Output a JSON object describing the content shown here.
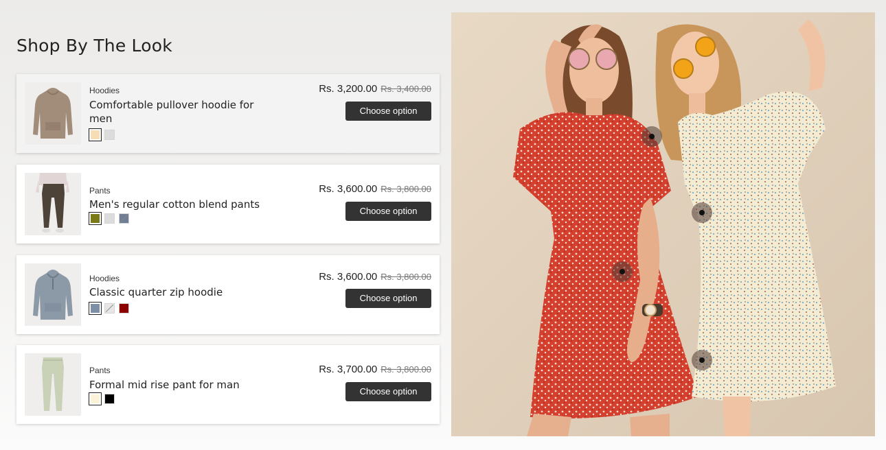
{
  "section": {
    "title": "Shop By The Look"
  },
  "products": [
    {
      "category": "Hoodies",
      "name": "Comfortable pullover hoodie for men",
      "price": "Rs. 3,200.00",
      "compare_price": "Rs. 3,400.00",
      "button": "Choose option",
      "image_icon": "hoodie-icon",
      "swatches": [
        "#f6ddb5",
        "#dcdcdc"
      ],
      "selected_swatch": 0
    },
    {
      "category": "Pants",
      "name": "Men's regular cotton blend pants",
      "price": "Rs. 3,600.00",
      "compare_price": "Rs. 3,800.00",
      "button": "Choose option",
      "image_icon": "pants-model-icon",
      "swatches": [
        "#7a7b16",
        "#dcdcdc",
        "#6f7e96"
      ],
      "selected_swatch": 0,
      "unavailable_swatches": [
        2
      ]
    },
    {
      "category": "Hoodies",
      "name": "Classic quarter zip hoodie",
      "price": "Rs. 3,600.00",
      "compare_price": "Rs. 3,800.00",
      "button": "Choose option",
      "image_icon": "zip-hoodie-icon",
      "swatches": [
        "#7d8fa5",
        "#e6e6e6",
        "#8b0000"
      ],
      "selected_swatch": 0,
      "unavailable_swatches": [
        1
      ]
    },
    {
      "category": "Pants",
      "name": "Formal mid rise pant for man",
      "price": "Rs. 3,700.00",
      "compare_price": "Rs. 3,800.00",
      "button": "Choose option",
      "image_icon": "pants-icon",
      "swatches": [
        "#fbf3d8",
        "#000000"
      ],
      "selected_swatch": 0
    }
  ],
  "lookbook": {
    "image_icon": "lookbook-photo",
    "hotspot_count": 4
  },
  "colors": {
    "button_bg": "#333333",
    "active_card_bg": "#f3f3f3"
  }
}
